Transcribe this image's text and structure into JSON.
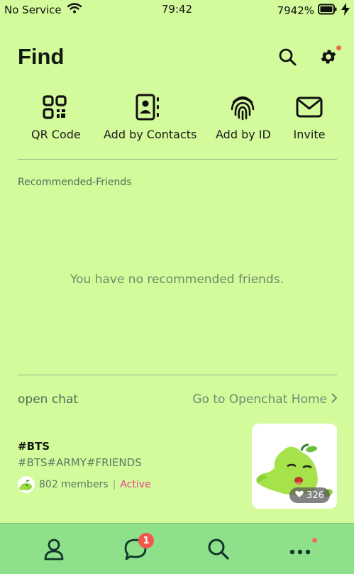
{
  "status_bar": {
    "carrier": "No Service",
    "time": "79:42",
    "battery": "7942%"
  },
  "header": {
    "title": "Find"
  },
  "actions": [
    {
      "label": "QR Code",
      "icon": "qr-code-icon"
    },
    {
      "label": "Add by Contacts",
      "icon": "contacts-icon"
    },
    {
      "label": "Add by ID",
      "icon": "fingerprint-icon"
    },
    {
      "label": "Invite",
      "icon": "mail-icon"
    }
  ],
  "recommended": {
    "section_label": "Recommended-Friends",
    "empty_message": "You have no recommended friends."
  },
  "open_chat": {
    "label": "open chat",
    "home_link": "Go to Openchat Home",
    "card": {
      "title": "#BTS",
      "tags": "#BTS#ARMY#FRIENDS",
      "members": "802 members",
      "separator": "|",
      "status": "Active",
      "likes": "326"
    }
  },
  "tabbar": {
    "items": [
      "person-icon",
      "chat-icon",
      "search-icon",
      "more-icon"
    ],
    "chat_badge": "1"
  },
  "colors": {
    "background": "#d3fa9b",
    "tabbar": "#8ee08b",
    "accent_active": "#ee3f8a",
    "badge": "#f0594a"
  }
}
